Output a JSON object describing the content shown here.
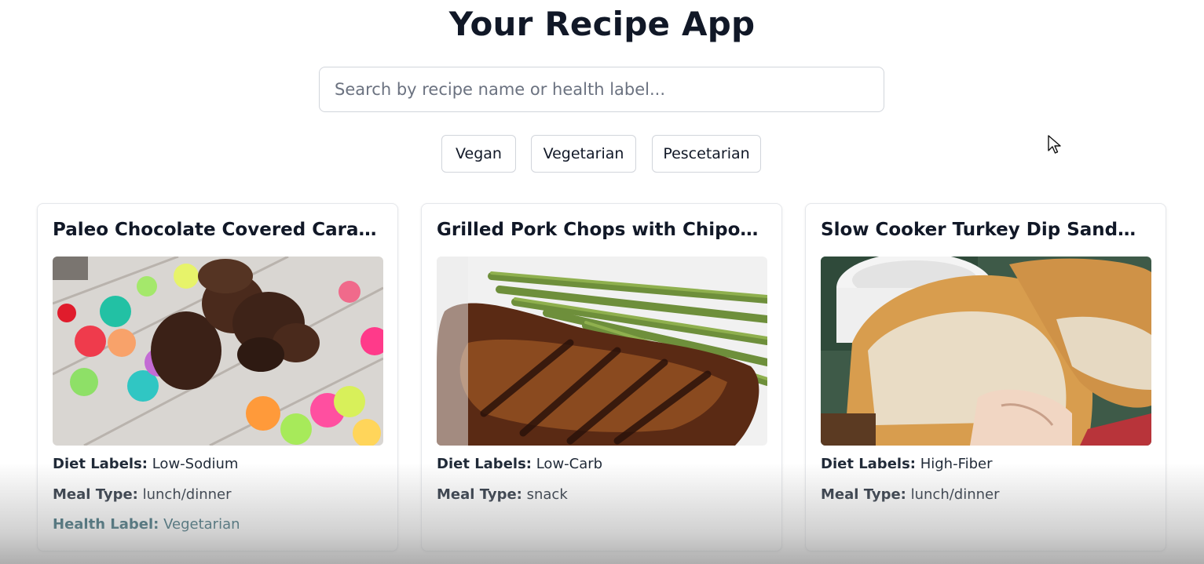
{
  "header": {
    "title": "Your Recipe App"
  },
  "search": {
    "placeholder": "Search by recipe name or health label..."
  },
  "filters": [
    "Vegan",
    "Vegetarian",
    "Pescetarian"
  ],
  "recipes": [
    {
      "title": "Paleo Chocolate Covered Caramels",
      "image": "chocolate-caramels-photo",
      "diet_label_key": "Diet Labels:",
      "diet_label": "Low-Sodium",
      "meal_type_key": "Meal Type:",
      "meal_type": "lunch/dinner",
      "health_label_key": "Health Label:",
      "health_label": "Vegetarian"
    },
    {
      "title": "Grilled Pork Chops with Chipotle...",
      "image": "pork-chop-asparagus-photo",
      "diet_label_key": "Diet Labels:",
      "diet_label": "Low-Carb",
      "meal_type_key": "Meal Type:",
      "meal_type": "snack"
    },
    {
      "title": "Slow Cooker Turkey Dip Sandwiche...",
      "image": "turkey-dip-sandwich-photo",
      "diet_label_key": "Diet Labels:",
      "diet_label": "High-Fiber",
      "meal_type_key": "Meal Type:",
      "meal_type": "lunch/dinner"
    }
  ],
  "colors": {
    "text": "#111827",
    "border": "#d1d5db",
    "health_label": "#0f4c5c"
  },
  "icons": {
    "cursor": "mouse-pointer-icon"
  }
}
